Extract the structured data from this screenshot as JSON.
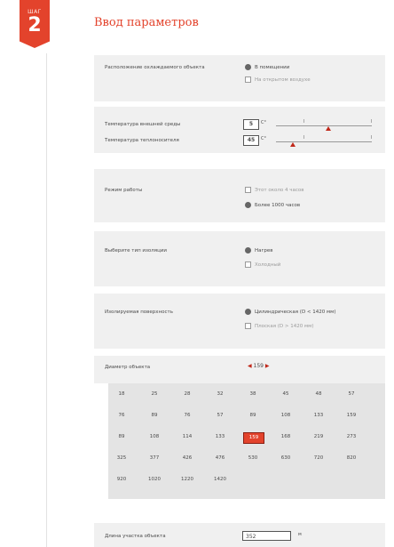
{
  "step": {
    "word": "ШАГ",
    "number": "2"
  },
  "page_title": "Ввод параметров",
  "location": {
    "label": "Расположение охлаждаемого объекта",
    "options": [
      {
        "label": "В помещении",
        "selected": true
      },
      {
        "label": "На открытом воздухе",
        "selected": false
      }
    ]
  },
  "temperatures": {
    "ambient_label": "Температура внешней среды",
    "ambient_value": "5",
    "ambient_unit": "С°",
    "ambient_level": 0.55,
    "fluid_label": "Температура теплоносителя",
    "fluid_value": "45",
    "fluid_unit": "С°",
    "fluid_level": 0.18
  },
  "mode": {
    "label": "Режим работы",
    "options": [
      {
        "label": "Этот около 4 часов",
        "selected": false
      },
      {
        "label": "Более 1000 часов",
        "selected": true
      }
    ]
  },
  "insulation": {
    "label": "Выберите тип изоляции",
    "options": [
      {
        "label": "Нагрев",
        "selected": true
      },
      {
        "label": "Холодный",
        "selected": false
      }
    ]
  },
  "surface": {
    "label": "Изолируемая поверхность",
    "options": [
      {
        "label": "Цилиндрическая (D < 1420 мм)",
        "selected": true
      },
      {
        "label": "Плоская (D > 1420 мм)",
        "selected": false
      }
    ]
  },
  "diameter": {
    "label": "Диаметр объекта",
    "value": "159",
    "rows": [
      [
        "18",
        "25",
        "28",
        "32",
        "38",
        "45",
        "48",
        "57"
      ],
      [
        "76",
        "89",
        "76",
        "57",
        "89",
        "108",
        "133",
        "159"
      ],
      [
        "89",
        "108",
        "114",
        "133",
        "159",
        "168",
        "219",
        "273"
      ],
      [
        "325",
        "377",
        "426",
        "476",
        "530",
        "630",
        "720",
        "820"
      ],
      [
        "920",
        "1020",
        "1220",
        "1420"
      ]
    ],
    "active_row": 2,
    "active_col": 4
  },
  "bottom_field": {
    "label": "Длина участка объекта",
    "value": "352",
    "unit": "м"
  },
  "colors": {
    "accent": "#e3432c",
    "panel": "#f0f0f0"
  }
}
